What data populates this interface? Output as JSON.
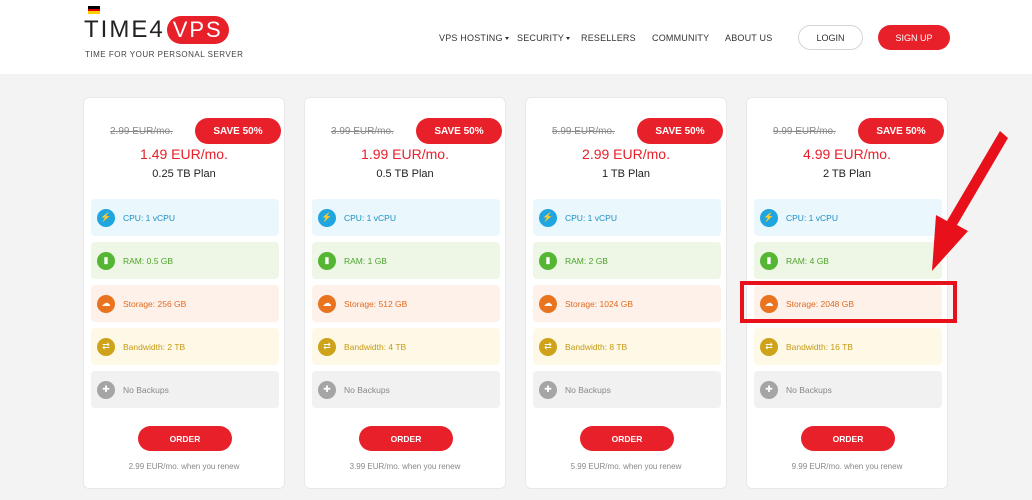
{
  "header": {
    "logo_text": "TIME4",
    "logo_badge": "VPS",
    "tagline": "TIME FOR YOUR PERSONAL SERVER",
    "nav": [
      {
        "label": "VPS HOSTING",
        "has_dropdown": true
      },
      {
        "label": "SECURITY",
        "has_dropdown": true
      },
      {
        "label": "RESELLERS",
        "has_dropdown": false
      },
      {
        "label": "COMMUNITY",
        "has_dropdown": false
      },
      {
        "label": "ABOUT US",
        "has_dropdown": false
      }
    ],
    "login_label": "LOGIN",
    "signup_label": "SIGN UP",
    "flag_colors": [
      "#000000",
      "#dd0000",
      "#ffce00"
    ]
  },
  "plans": [
    {
      "old_price": "2.99 EUR/mo.",
      "save": "SAVE 50%",
      "price": "1.49 EUR/mo.",
      "name": "0.25 TB Plan",
      "cpu": "CPU: 1 vCPU",
      "ram": "RAM: 0.5 GB",
      "storage": "Storage: 256 GB",
      "bandwidth": "Bandwidth: 2 TB",
      "backups": "No Backups",
      "order": "ORDER",
      "renew": "2.99 EUR/mo. when you renew"
    },
    {
      "old_price": "3.99 EUR/mo.",
      "save": "SAVE 50%",
      "price": "1.99 EUR/mo.",
      "name": "0.5 TB Plan",
      "cpu": "CPU: 1 vCPU",
      "ram": "RAM: 1 GB",
      "storage": "Storage: 512 GB",
      "bandwidth": "Bandwidth: 4 TB",
      "backups": "No Backups",
      "order": "ORDER",
      "renew": "3.99 EUR/mo. when you renew"
    },
    {
      "old_price": "5.99 EUR/mo.",
      "save": "SAVE 50%",
      "price": "2.99 EUR/mo.",
      "name": "1 TB Plan",
      "cpu": "CPU: 1 vCPU",
      "ram": "RAM: 2 GB",
      "storage": "Storage: 1024 GB",
      "bandwidth": "Bandwidth: 8 TB",
      "backups": "No Backups",
      "order": "ORDER",
      "renew": "5.99 EUR/mo. when you renew"
    },
    {
      "old_price": "9.99 EUR/mo.",
      "save": "SAVE 50%",
      "price": "4.99 EUR/mo.",
      "name": "2 TB Plan",
      "cpu": "CPU: 1 vCPU",
      "ram": "RAM: 4 GB",
      "storage": "Storage: 2048 GB",
      "bandwidth": "Bandwidth: 16 TB",
      "backups": "No Backups",
      "order": "ORDER",
      "renew": "9.99 EUR/mo. when you renew"
    }
  ],
  "annotation": {
    "color": "#e8101a",
    "highlighted": "plans.3.storage"
  },
  "colors": {
    "brand_red": "#e8202a",
    "cpu": "#1fa5e0",
    "ram": "#55b634",
    "storage": "#ea7320",
    "bandwidth": "#cea31a",
    "backups": "#a5a5a5"
  },
  "icons": {
    "cpu": "lightning-icon",
    "ram": "memory-chip-icon",
    "storage": "cloud-upload-icon",
    "bandwidth": "transfer-arrows-icon",
    "backups": "backup-lifebuoy-icon"
  }
}
